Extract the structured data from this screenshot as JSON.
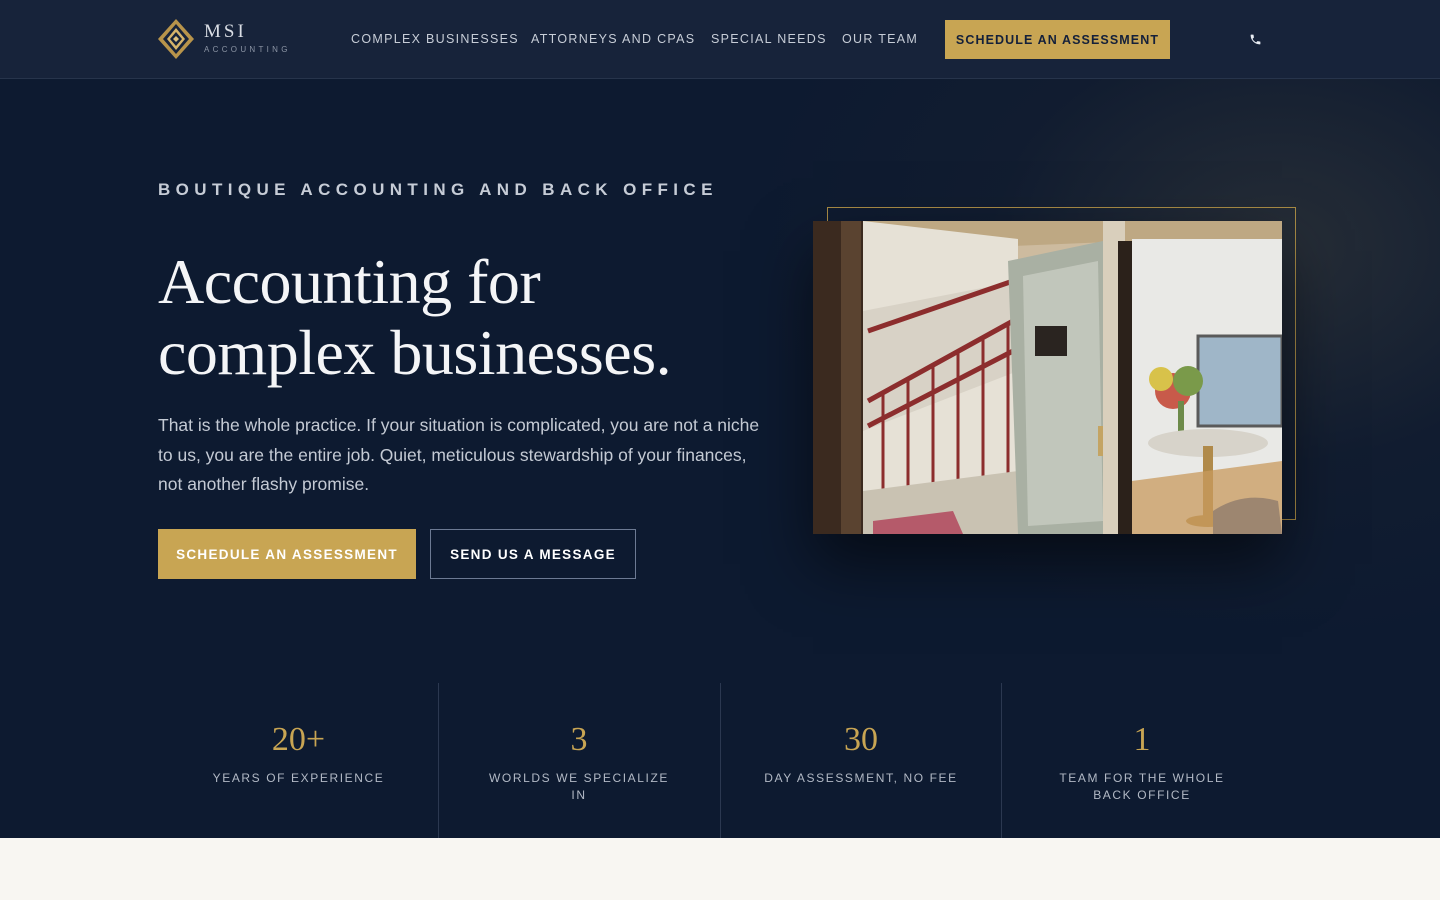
{
  "nav": {
    "logo_name": "MSI",
    "logo_sub": "ACCOUNTING",
    "links": [
      "COMPLEX BUSINESSES",
      "ATTORNEYS AND CPAS",
      "SPECIAL NEEDS",
      "OUR TEAM"
    ],
    "cta_label": "SCHEDULE AN ASSESSMENT",
    "phone_icon": "phone-icon"
  },
  "hero": {
    "eyebrow": "BOUTIQUE ACCOUNTING AND BACK OFFICE",
    "headline_line1": "Accounting for",
    "headline_line2": "complex businesses.",
    "lede": "That is the whole practice. If your situation is complicated, you are not a niche to us, you are the entire job. Quiet, meticulous stewardship of your finances, not another flashy promise.",
    "primary_button": "SCHEDULE AN ASSESSMENT",
    "secondary_button": "SEND US A MESSAGE",
    "photo_alt": "Office entrance with stairwell and sitting room"
  },
  "stats": [
    {
      "value": "20+",
      "label": "YEARS OF EXPERIENCE"
    },
    {
      "value": "3",
      "label": "WORLDS WE SPECIALIZE IN"
    },
    {
      "value": "30",
      "label": "DAY ASSESSMENT, NO FEE"
    },
    {
      "value": "1",
      "label": "TEAM FOR THE WHOLE BACK OFFICE"
    }
  ],
  "colors": {
    "navy": "#0d1a30",
    "nav_bg": "#17233a",
    "gold": "#c8a553",
    "light_band": "#f8f6f2"
  }
}
